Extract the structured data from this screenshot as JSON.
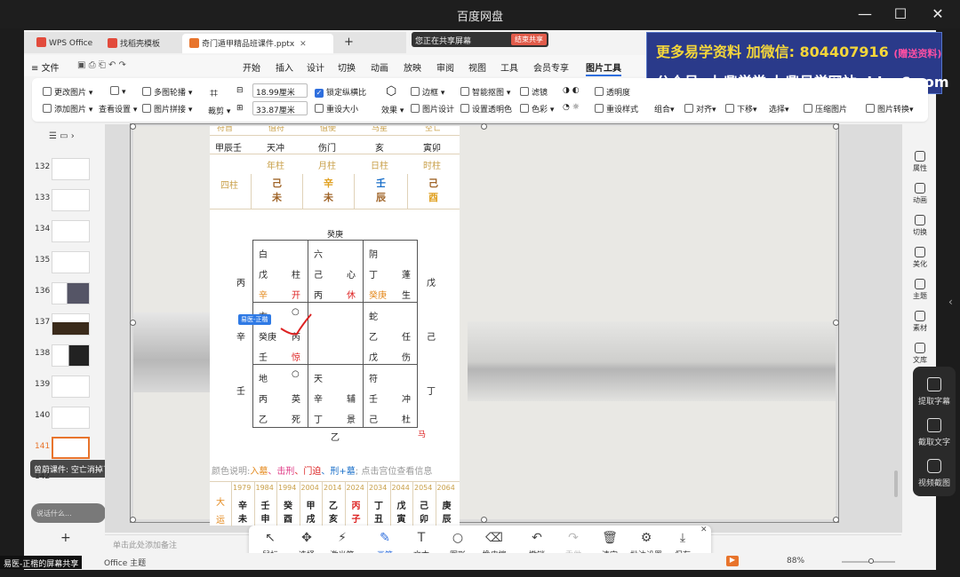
{
  "window": {
    "title": "百度网盘",
    "min": "—",
    "max": "☐",
    "close": "✕"
  },
  "share": {
    "text": "您正在共享屏幕",
    "end": "结束共享"
  },
  "tabs": [
    {
      "label": "WPS Office",
      "color": "#e24b3c"
    },
    {
      "label": "找稻壳模板",
      "color": "#e24b3c"
    },
    {
      "label": "奇门遁甲精品班课件.pptx",
      "color": "#e8742c"
    }
  ],
  "tab_add": "+",
  "menu": {
    "file": "文件",
    "items": [
      "开始",
      "插入",
      "设计",
      "切换",
      "动画",
      "放映",
      "审阅",
      "视图",
      "工具",
      "会员专享",
      "图片工具"
    ]
  },
  "ad": {
    "line1": "更多易学资料 加微信: 804407916",
    "line1_tail": "(赠送资料)",
    "line2": "公众号: 九鼎学堂 九鼎易学网站: jdyx6.com"
  },
  "ribbon": {
    "change": "更改图片",
    "add": "添加图片",
    "multi": "多图轮播",
    "check": "查看设置",
    "puzzle": "图片拼接",
    "crop": "裁剪",
    "width": "18.99厘米",
    "height": "33.87厘米",
    "lock": "锁定纵横比",
    "reset": "重设大小",
    "effect": "效果",
    "border": "边框",
    "design": "图片设计",
    "smart": "智能抠图",
    "transparent": "设置透明色",
    "filter": "滤镜",
    "color": "色彩",
    "transp": "透明度",
    "resetstyle": "重设样式",
    "group": "组合",
    "align": "对齐",
    "down": "下移",
    "select": "选择",
    "compress": "压缩图片",
    "convert": "图片转换"
  },
  "thumbs": [
    "132",
    "133",
    "134",
    "135",
    "136",
    "137",
    "138",
    "139",
    "140",
    "141",
    "142"
  ],
  "thumb_overlay": "曾蔚课件: 空亡消掉了",
  "thumb_voice": "说话什么...",
  "add_slide": "+",
  "note": "单击此处添加备注",
  "rightbar": [
    "属性",
    "动画",
    "切换",
    "美化",
    "主题",
    "素材",
    "文库"
  ],
  "capture": [
    "提取字幕",
    "截取文字",
    "视频截图"
  ],
  "draw": [
    "鼠标",
    "选择",
    "激光笔",
    "画笔",
    "文本",
    "图形",
    "橡皮擦",
    "撤销",
    "重做",
    "清空",
    "批注设置",
    "保存"
  ],
  "status": {
    "presenter": "易医-正楷的屏幕共享",
    "theme": "Office 主题",
    "zoom": "88%"
  },
  "doc": {
    "top_hdr": [
      "符首",
      "值符",
      "值使",
      "马星",
      "空亡"
    ],
    "row1": [
      "甲辰壬",
      "天冲",
      "伤门",
      "亥",
      "寅卯"
    ],
    "pillars_hdr": [
      "年柱",
      "月柱",
      "日柱",
      "时柱"
    ],
    "pillars_label": "四柱",
    "pillars": [
      [
        "己",
        "未"
      ],
      [
        "辛",
        "未"
      ],
      [
        "壬",
        "辰"
      ],
      [
        "己",
        "酉"
      ]
    ],
    "top_label": "癸庚",
    "side_left": [
      "丙",
      "辛",
      "壬"
    ],
    "side_right": [
      "戊",
      "己",
      "丁"
    ],
    "bottom_label": "乙",
    "horse": "马",
    "palaces": [
      [
        "白",
        "",
        "戊",
        "柱",
        "辛",
        "开"
      ],
      [
        "六",
        "",
        "己",
        "心",
        "丙",
        "休"
      ],
      [
        "阴",
        "",
        "丁",
        "蓬",
        "癸庚",
        "生"
      ],
      [
        "玄",
        "○",
        "癸庚",
        "芮",
        "壬",
        "惊"
      ],
      [
        "",
        "",
        "",
        "",
        "",
        ""
      ],
      [
        "蛇",
        "",
        "乙",
        "任",
        "戊",
        "伤"
      ],
      [
        "地",
        "○",
        "丙",
        "英",
        "乙",
        "死"
      ],
      [
        "天",
        "",
        "辛",
        "辅",
        "丁",
        "景"
      ],
      [
        "符",
        "",
        "壬",
        "冲",
        "己",
        "杜"
      ]
    ],
    "cursor_tag": "易医-正楷",
    "legend": [
      "颜色说明:",
      "入墓",
      "、击刑",
      "、门迫",
      "、刑+墓",
      "; 点击宫位查看信息"
    ],
    "years": [
      "1979",
      "1984",
      "1994",
      "2004",
      "2014",
      "2024",
      "2034",
      "2044",
      "2054",
      "2064"
    ],
    "luck_label": [
      "大",
      "运"
    ],
    "luck_top": [
      "辛",
      "壬",
      "癸",
      "甲",
      "乙",
      "丙",
      "丁",
      "戊",
      "己",
      "庚"
    ],
    "luck_bot": [
      "未",
      "申",
      "酉",
      "戌",
      "亥",
      "子",
      "丑",
      "寅",
      "卯",
      "辰"
    ]
  }
}
